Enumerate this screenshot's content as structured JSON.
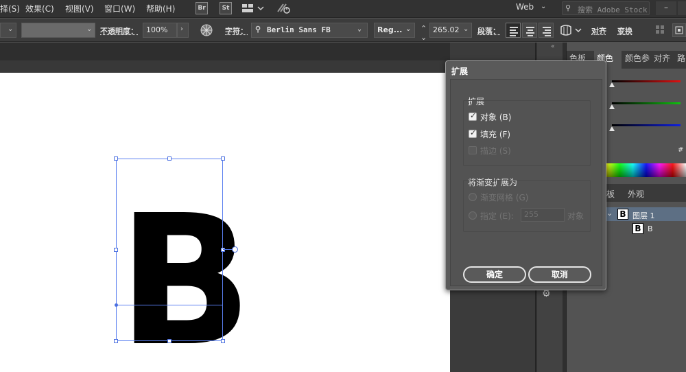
{
  "menubar": {
    "items": [
      "择(S)",
      "效果(C)",
      "视图(V)",
      "窗口(W)",
      "帮助(H)"
    ],
    "bridge_icon": "Br",
    "stock_icon": "St",
    "workspace": "Web",
    "search_placeholder": "搜索 Adobe Stock",
    "minimize": "–"
  },
  "controlbar": {
    "opacity_label": "不透明度：",
    "opacity_value": "100%",
    "char_label": "字符：",
    "font_family": "Berlin Sans FB",
    "font_style": "Reg...",
    "font_size": "265.02",
    "para_label": "段落：",
    "align_label": "对齐",
    "transform_label": "变换"
  },
  "canvas": {
    "glyph": "B"
  },
  "color_panel": {
    "tabs": [
      "色板",
      "颜色",
      "颜色参",
      "对齐",
      "路"
    ],
    "active_tab": "颜色",
    "hash": "#",
    "colors": {
      "red": "#e01010",
      "green": "#10c010",
      "blue": "#1020e0"
    }
  },
  "layers_panel": {
    "tabs": [
      "板",
      "外观"
    ],
    "layers": [
      {
        "thumb": "B",
        "name": "图层 1"
      },
      {
        "thumb": "B",
        "name": "B"
      }
    ]
  },
  "dialog": {
    "title": "扩展",
    "expand_group": "扩展",
    "object_label": "对象 (B)",
    "fill_label": "填充 (F)",
    "stroke_label": "描边 (S)",
    "gradient_group": "将渐变扩展为",
    "gradient_mesh_label": "渐变网格 (G)",
    "specify_label": "指定 (E):",
    "specify_value": "255",
    "specify_unit": "对象",
    "ok": "确定",
    "cancel": "取消"
  }
}
